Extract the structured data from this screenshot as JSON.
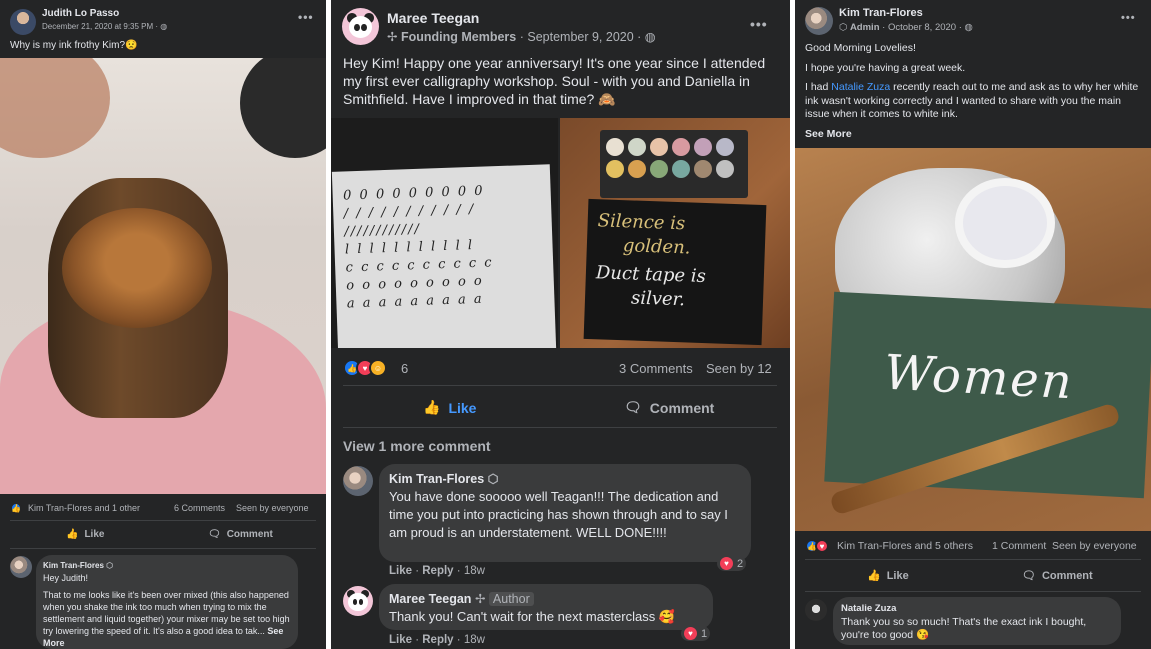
{
  "post1": {
    "author": "Judith Lo Passo",
    "timestamp": "December 21, 2020 at 9:35 PM",
    "text": "Why is my ink frothy Kim?😟",
    "reactions_text": "Kim Tran-Flores and 1 other",
    "comments_count": "6 Comments",
    "seen": "Seen by everyone",
    "like_label": "Like",
    "comment_label": "Comment",
    "comment": {
      "author": "Kim Tran-Flores",
      "greeting": "Hey Judith!",
      "body": "That to me looks like it's been over mixed (this also happened when you shake the ink too much when trying to mix the settlement and liquid together) your mixer may be set too high try lowering the speed of it. It's also a good idea to tak...",
      "see_more": "See More"
    }
  },
  "post2": {
    "author": "Maree Teegan",
    "group_badge": "Founding Members",
    "timestamp": "September 9, 2020",
    "text": "Hey Kim! Happy one year anniversary! It's one year since I attended my first ever calligraphy workshop. Soul - with you and Daniella in Smithfield. Have I improved in that time? 🙈",
    "image_right_text_line1": "Silence is",
    "image_right_text_line2": "golden.",
    "image_right_text_line3": "Duct tape is",
    "image_right_text_line4": "silver.",
    "reaction_count": "6",
    "comments_count": "3 Comments",
    "seen": "Seen by 12",
    "like_label": "Like",
    "comment_label": "Comment",
    "view_more": "View 1 more comment",
    "comments": [
      {
        "author": "Kim Tran-Flores",
        "text": "You have done sooooo well Teagan!!! The dedication and time you put into practicing has shown through and to say I am proud is an understatement. WELL DONE!!!!",
        "like": "Like",
        "reply": "Reply",
        "age": "18w",
        "reactions": "2"
      },
      {
        "author": "Maree Teegan",
        "badge": "Author",
        "text": "Thank you! Can't wait for the next masterclass 🥰",
        "like": "Like",
        "reply": "Reply",
        "age": "18w",
        "reactions": "1"
      }
    ]
  },
  "post3": {
    "author": "Kim Tran-Flores",
    "role": "Admin",
    "timestamp": "October 8, 2020",
    "line1": "Good Morning Lovelies!",
    "line2": "I hope you're having a great week.",
    "line3_pre": "I had ",
    "line3_link": "Natalie Zuza",
    "line3_post": " recently reach out to me and ask as to why her white ink wasn't working correctly and I wanted to share with you the main issue when it comes to white ink.",
    "see_more": "See More",
    "card_text": "Women",
    "reactions_text": "Kim Tran-Flores and 5 others",
    "comments_count": "1 Comment",
    "seen": "Seen by everyone",
    "like_label": "Like",
    "comment_label": "Comment",
    "comment": {
      "author": "Natalie Zuza",
      "text": "Thank you so so much! That's the exact ink I bought, you're too good 😘"
    }
  },
  "colors": {
    "panel_bg": "#242526",
    "bubble_bg": "#3a3b3c",
    "text": "#e4e6eb",
    "muted": "#b0b3b8",
    "like_blue": "#4599ff",
    "love_red": "#f33e58"
  },
  "icons": [
    "more-options-icon",
    "globe-icon",
    "founding-member-icon",
    "admin-shield-icon",
    "like-icon",
    "comment-icon",
    "like-reaction-icon",
    "love-reaction-icon",
    "haha-reaction-icon"
  ]
}
